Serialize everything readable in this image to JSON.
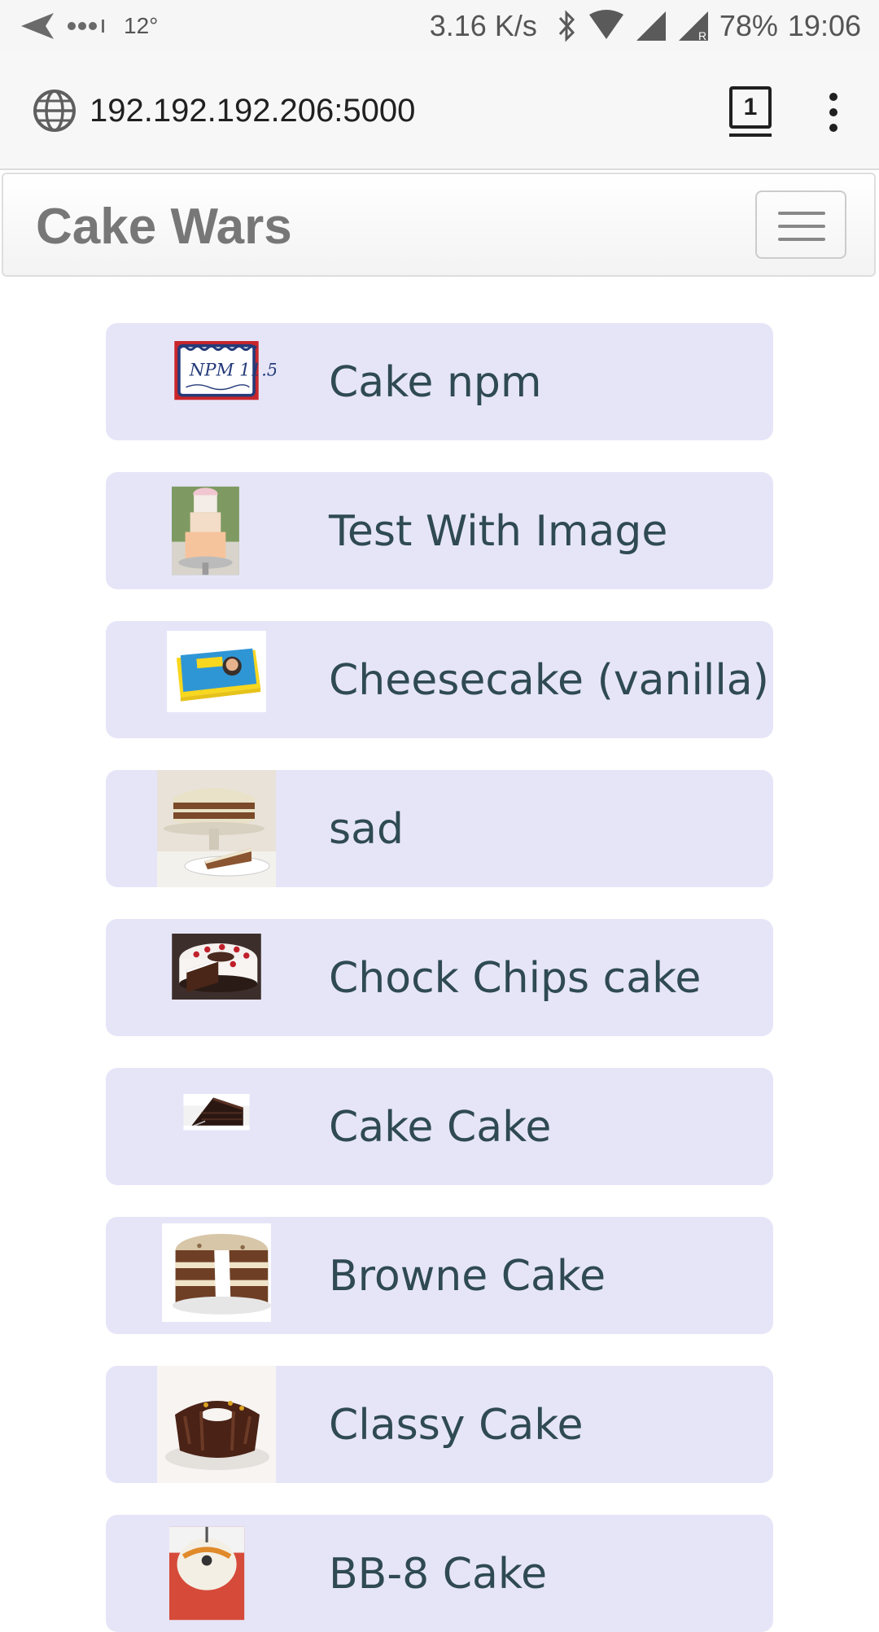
{
  "status_bar": {
    "temperature": "12°",
    "network_speed": "3.16 K/s",
    "battery": "78%",
    "time": "19:06"
  },
  "browser": {
    "url": "192.192.192.206:5000",
    "tab_count": "1"
  },
  "navbar": {
    "brand": "Cake Wars"
  },
  "cakes": [
    {
      "name": "Cake npm"
    },
    {
      "name": "Test With Image"
    },
    {
      "name": "Cheesecake (vanilla)"
    },
    {
      "name": "sad"
    },
    {
      "name": "Chock Chips cake"
    },
    {
      "name": "Cake Cake"
    },
    {
      "name": "Browne Cake"
    },
    {
      "name": "Classy Cake"
    },
    {
      "name": "BB-8 Cake"
    }
  ]
}
